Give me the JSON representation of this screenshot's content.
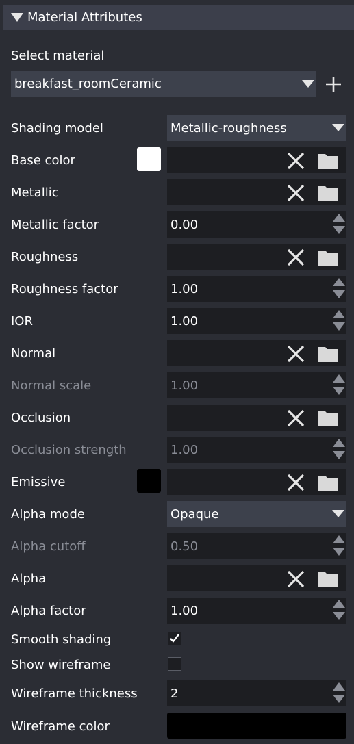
{
  "section": {
    "title": "Material Attributes",
    "icon": "collapse-triangle-icon"
  },
  "material": {
    "label": "Select material",
    "value": "breakfast_roomCeramic"
  },
  "fields": {
    "shading_model": {
      "label": "Shading model",
      "value": "Metallic-roughness"
    },
    "base_color": {
      "label": "Base color",
      "color": "#ffffff"
    },
    "metallic": {
      "label": "Metallic"
    },
    "metallic_factor": {
      "label": "Metallic factor",
      "value": "0.00"
    },
    "roughness": {
      "label": "Roughness"
    },
    "roughness_factor": {
      "label": "Roughness factor",
      "value": "1.00"
    },
    "ior": {
      "label": "IOR",
      "value": "1.00"
    },
    "normal": {
      "label": "Normal"
    },
    "normal_scale": {
      "label": "Normal scale",
      "value": "1.00"
    },
    "occlusion": {
      "label": "Occlusion"
    },
    "occlusion_strength": {
      "label": "Occlusion strength",
      "value": "1.00"
    },
    "emissive": {
      "label": "Emissive",
      "color": "#000000"
    },
    "alpha_mode": {
      "label": "Alpha mode",
      "value": "Opaque"
    },
    "alpha_cutoff": {
      "label": "Alpha cutoff",
      "value": "0.50"
    },
    "alpha": {
      "label": "Alpha"
    },
    "alpha_factor": {
      "label": "Alpha factor",
      "value": "1.00"
    },
    "smooth_shading": {
      "label": "Smooth shading",
      "checked": true
    },
    "show_wireframe": {
      "label": "Show wireframe",
      "checked": false
    },
    "wireframe_thickness": {
      "label": "Wireframe thickness",
      "value": "2"
    },
    "wireframe_color": {
      "label": "Wireframe color",
      "color": "#000000"
    }
  },
  "colors": {
    "panel_bg": "#2b2d34",
    "header_bg": "#3c3f4b",
    "field_bg": "#1d1e22",
    "dropdown_bg": "#3d414c",
    "disabled_text": "#8a8d96"
  }
}
